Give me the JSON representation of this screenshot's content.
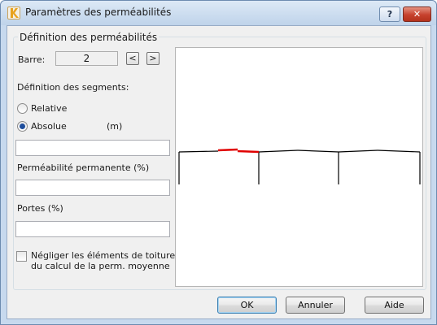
{
  "window": {
    "title": "Paramètres des perméabilités",
    "help_label": "?",
    "close_label": "✕"
  },
  "group": {
    "title": "Définition des perméabilités"
  },
  "barre": {
    "label": "Barre:",
    "value": "2",
    "prev_label": "<",
    "next_label": ">"
  },
  "segments": {
    "label": "Définition des segments:",
    "relative_label": "Relative",
    "absolue_label": "Absolue",
    "unit": "(m)",
    "selected": "Absolue",
    "value": ""
  },
  "permeabilite": {
    "label": "Perméabilité permanente (%)",
    "value": ""
  },
  "portes": {
    "label": "Portes (%)",
    "value": ""
  },
  "negliger": {
    "label_line1": "Négliger les éléments de toiture lors",
    "label_line2": "du calcul de la perm. moyenne",
    "checked": false
  },
  "buttons": {
    "ok": "OK",
    "annuler": "Annuler",
    "aide": "Aide"
  },
  "colors": {
    "accent": "#1f4e9c",
    "selected_segment": "#e00000"
  },
  "icons": [
    "app-icon",
    "help-icon",
    "close-icon"
  ]
}
